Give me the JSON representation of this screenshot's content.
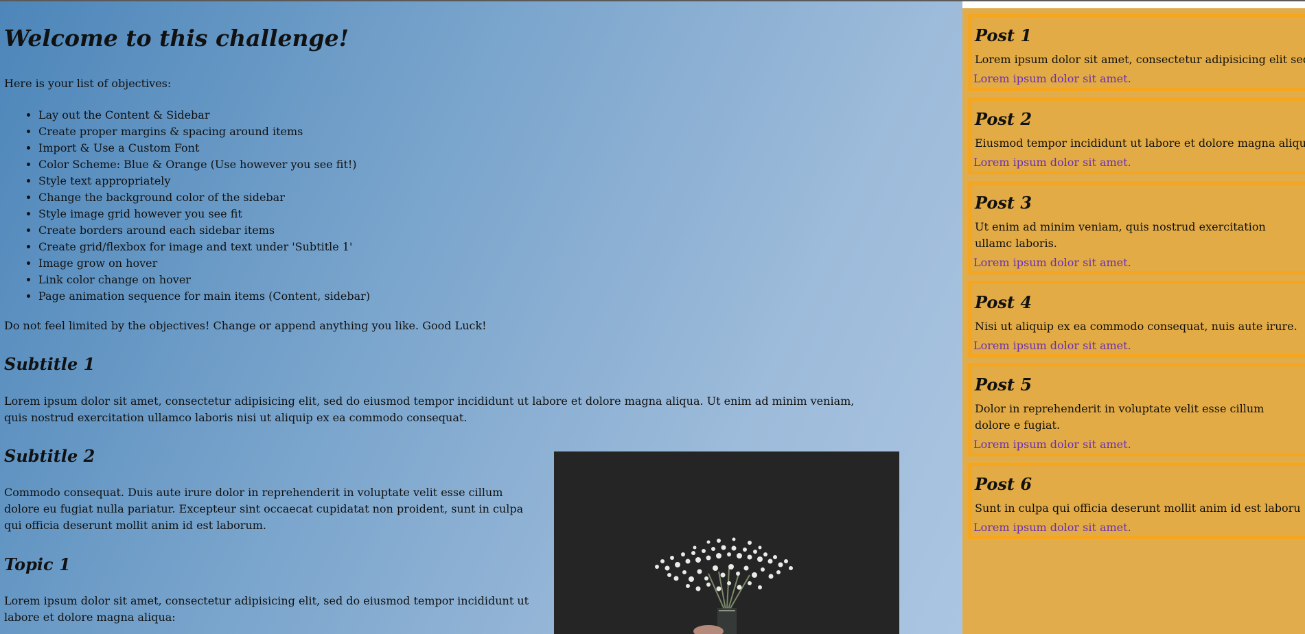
{
  "content": {
    "title": "Welcome to this challenge!",
    "intro": "Here is your list of objectives:",
    "objectives": [
      "Lay out the Content & Sidebar",
      "Create proper margins & spacing around items",
      "Import & Use a Custom Font",
      "Color Scheme: Blue & Orange (Use however you see fit!)",
      "Style text appropriately",
      "Change the background color of the sidebar",
      "Style image grid however you see fit",
      "Create borders around each sidebar items",
      "Create grid/flexbox for image and text under 'Subtitle 1'",
      "Image grow on hover",
      "Link color change on hover",
      "Page animation sequence for main items (Content, sidebar)"
    ],
    "outro": "Do not feel limited by the objectives! Change or append anything you like. Good Luck!",
    "subtitle1": "Subtitle 1",
    "subtitle1_text": "Lorem ipsum dolor sit amet, consectetur adipisicing elit, sed do eiusmod tempor incididunt ut labore et dolore magna aliqua. Ut enim ad minim veniam, quis nostrud exercitation ullamco laboris nisi ut aliquip ex ea commodo consequat.",
    "subtitle2": "Subtitle 2",
    "subtitle2_text": "Commodo consequat. Duis aute irure dolor in reprehenderit in voluptate velit esse cillum dolore eu fugiat nulla pariatur. Excepteur sint occaecat cupidatat non proident, sunt in culpa qui officia deserunt mollit anim id est laborum.",
    "topic1": "Topic 1",
    "topic1_text": "Lorem ipsum dolor sit amet, consectetur adipisicing elit, sed do eiusmod tempor incididunt ut labore et dolore magna aliqua:"
  },
  "sidebar": {
    "posts": [
      {
        "title": "Post 1",
        "text": "Lorem ipsum dolor sit amet, consectetur adipisicing elit sed",
        "link": "Lorem ipsum dolor sit amet."
      },
      {
        "title": "Post 2",
        "text": "Eiusmod tempor incididunt ut labore et dolore magna aliqu",
        "link": "Lorem ipsum dolor sit amet."
      },
      {
        "title": "Post 3",
        "text": "Ut enim ad minim veniam, quis nostrud exercitation ullamc laboris.",
        "link": "Lorem ipsum dolor sit amet."
      },
      {
        "title": "Post 4",
        "text": "Nisi ut aliquip ex ea commodo consequat, nuis aute irure.",
        "link": "Lorem ipsum dolor sit amet."
      },
      {
        "title": "Post 5",
        "text": "Dolor in reprehenderit in voluptate velit esse cillum dolore e fugiat.",
        "link": "Lorem ipsum dolor sit amet."
      },
      {
        "title": "Post 6",
        "text": "Sunt in culpa qui officia deserunt mollit anim id est laboru",
        "link": "Lorem ipsum dolor sit amet."
      }
    ]
  },
  "colors": {
    "main_background_start": "#4d86ba",
    "main_background_end": "#aac5e1",
    "sidebar_background": "#e1ad4c",
    "post_border": "#f5a51e",
    "link": "#6a2fb0"
  },
  "images": {
    "photo": "flower-bouquet-photo"
  }
}
